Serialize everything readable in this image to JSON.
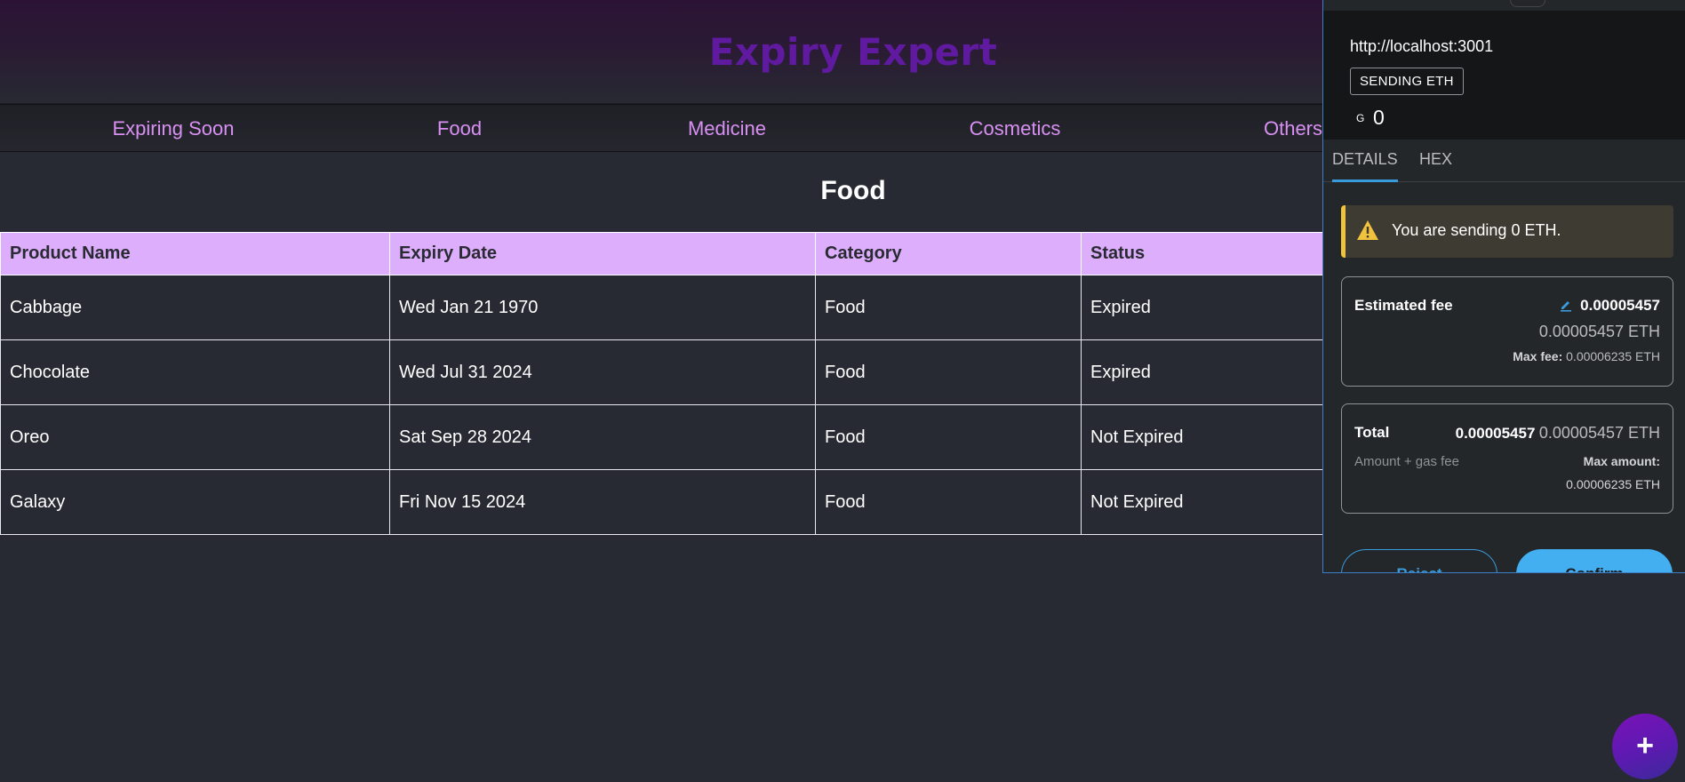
{
  "app": {
    "title": "Expiry Expert"
  },
  "nav": {
    "items": [
      {
        "label": "Expiring Soon"
      },
      {
        "label": "Food"
      },
      {
        "label": "Medicine"
      },
      {
        "label": "Cosmetics"
      },
      {
        "label": "Others"
      }
    ]
  },
  "section": {
    "title": "Food"
  },
  "table": {
    "headers": [
      "Product Name",
      "Expiry Date",
      "Category",
      "Status"
    ],
    "rows": [
      [
        "Cabbage",
        "Wed Jan 21 1970",
        "Food",
        "Expired"
      ],
      [
        "Chocolate",
        "Wed Jul 31 2024",
        "Food",
        "Expired"
      ],
      [
        "Oreo",
        "Sat Sep 28 2024",
        "Food",
        "Not Expired"
      ],
      [
        "Galaxy",
        "Fri Nov 15 2024",
        "Food",
        "Not Expired"
      ]
    ]
  },
  "wallet": {
    "origin": "http://localhost:3001",
    "badge": "SENDING ETH",
    "token_symbol": "G",
    "amount": "0",
    "tabs": [
      {
        "label": "DETAILS"
      },
      {
        "label": "HEX"
      }
    ],
    "warning": "You are sending 0 ETH.",
    "fee": {
      "label": "Estimated fee",
      "value": "0.00005457",
      "value_eth": "0.00005457 ETH",
      "max_label": "Max fee:",
      "max_value": "0.00006235 ETH"
    },
    "total": {
      "label": "Total",
      "value": "0.00005457",
      "value_eth": "0.00005457 ETH",
      "sub_label": "Amount + gas fee",
      "max_label": "Max amount:",
      "max_value": "0.00006235 ETH"
    },
    "reject_label": "Reject",
    "confirm_label": "Confirm",
    "accent_color": "#43aef0",
    "warning_color": "#f0c23d"
  },
  "fab": {
    "label": "+"
  }
}
